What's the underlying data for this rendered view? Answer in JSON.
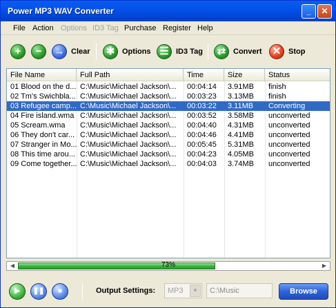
{
  "window": {
    "title": "Power MP3 WAV Converter",
    "min_glyph": "_",
    "close_glyph": "✕"
  },
  "menu": [
    {
      "label": "File",
      "enabled": true
    },
    {
      "label": "Action",
      "enabled": true
    },
    {
      "label": "Options",
      "enabled": false
    },
    {
      "label": "ID3 Tag",
      "enabled": false
    },
    {
      "label": "Purchase",
      "enabled": true
    },
    {
      "label": "Register",
      "enabled": true
    },
    {
      "label": "Help",
      "enabled": true
    }
  ],
  "toolbar": {
    "clear_label": "Clear",
    "options_label": "Options",
    "id3_label": "ID3 Tag",
    "convert_label": "Convert",
    "stop_label": "Stop",
    "add_glyph": "+",
    "remove_glyph": "−",
    "next_glyph": "→",
    "options_glyph": "✱",
    "id3_glyph": "☰",
    "convert_glyph": "⇄",
    "stop_glyph": "✕"
  },
  "table": {
    "columns": [
      "File Name",
      "Full Path",
      "Time",
      "Size",
      "Status"
    ],
    "rows": [
      {
        "name": "01 Blood on the d...",
        "path": "C:\\Music\\Michael Jackson\\...",
        "time": "00:04:14",
        "size": "3.91MB",
        "status": "finish",
        "selected": false
      },
      {
        "name": "02 Tm's Swichbla...",
        "path": "C:\\Music\\Michael Jackson\\...",
        "time": "00:03:23",
        "size": "3.13MB",
        "status": "finish",
        "selected": false
      },
      {
        "name": "03 Refugee camp...",
        "path": "C:\\Music\\Michael Jackson\\...",
        "time": "00:03:22",
        "size": "3.11MB",
        "status": "Converting",
        "selected": true
      },
      {
        "name": "04 Fire island.wma",
        "path": "C:\\Music\\Michael Jackson\\...",
        "time": "00:03:52",
        "size": "3.58MB",
        "status": "unconverted",
        "selected": false
      },
      {
        "name": "05 Scream.wma",
        "path": "C:\\Music\\Michael Jackson\\...",
        "time": "00:04:40",
        "size": "4.31MB",
        "status": "unconverted",
        "selected": false
      },
      {
        "name": "06 They don't car...",
        "path": "C:\\Music\\Michael Jackson\\...",
        "time": "00:04:46",
        "size": "4.41MB",
        "status": "unconverted",
        "selected": false
      },
      {
        "name": "07 Stranger in Mo...",
        "path": "C:\\Music\\Michael Jackson\\...",
        "time": "00:05:45",
        "size": "5.31MB",
        "status": "unconverted",
        "selected": false
      },
      {
        "name": "08 This time arou...",
        "path": "C:\\Music\\Michael Jackson\\...",
        "time": "00:04:23",
        "size": "4.05MB",
        "status": "unconverted",
        "selected": false
      },
      {
        "name": "09 Come together...",
        "path": "C:\\Music\\Michael Jackson\\...",
        "time": "00:04:03",
        "size": "3.74MB",
        "status": "unconverted",
        "selected": false
      }
    ]
  },
  "progress": {
    "percent": 73,
    "label": "73%",
    "left_arrow": "◀",
    "right_arrow": "▶"
  },
  "bottom": {
    "play_glyph": "▶",
    "pause_glyph": "❚❚",
    "stop_glyph": "■",
    "output_label": "Output Settings:",
    "format_value": "MP3",
    "format_arrow": "▼",
    "path_value": "C:\\Music",
    "browse_label": "Browse"
  },
  "colors": {
    "selection": "#316ac5",
    "titlebar": "#0655f0"
  }
}
